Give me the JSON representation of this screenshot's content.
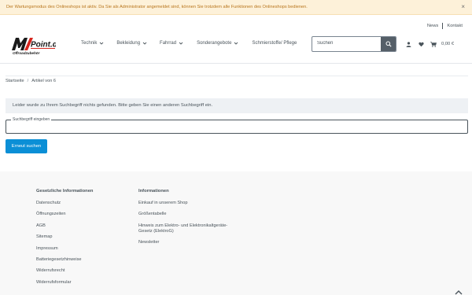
{
  "maintenance": {
    "text": "Der Wartungsmodus des Onlineshops ist aktiv. Da Sie als Administrator angemeldet sind, können Sie trotzdem alle Funktionen des Onlineshops bedienen.",
    "close": "×"
  },
  "top_links": {
    "news": "News",
    "contact": "Kontakt"
  },
  "logo": {
    "brand": "MX-Point.de",
    "tagline": "Offroadzubehör"
  },
  "nav": [
    {
      "label": "Technik",
      "dropdown": true
    },
    {
      "label": "Bekleidung",
      "dropdown": true
    },
    {
      "label": "Fahrrad",
      "dropdown": true
    },
    {
      "label": "Sonderangebote",
      "dropdown": true
    },
    {
      "label": "Schmierstoffe/ Pflege",
      "dropdown": false
    }
  ],
  "search": {
    "placeholder": "Suchen"
  },
  "cart": {
    "total": "0,00 €"
  },
  "breadcrumb": {
    "home": "Startseite",
    "current": "Artikel von 6"
  },
  "alert": {
    "text": "Leider wurde zu Ihrem Suchbegriff nichts gefunden. Bitte geben Sie einen anderen Suchbegriff ein."
  },
  "search_form": {
    "label": "Suchbegriff eingeben",
    "value": "",
    "button": "Erneut suchen"
  },
  "footer": {
    "legal": {
      "title": "Gesetzliche Informationen",
      "links": [
        "Datenschutz",
        "Öffnungszeiten",
        "AGB",
        "Sitemap",
        "Impressum",
        "Batteriegesetzhinweise",
        "Widerrufsrecht",
        "Widerrufsformular"
      ]
    },
    "info": {
      "title": "Informationen",
      "links": [
        "Einkauf in unserem Shop",
        "Größentabelle",
        "Hinweis zum Elektro- und Elektronikaltgeräte-Gesetz (ElektroG)",
        "Newsletter"
      ]
    }
  },
  "colors": {
    "accent": "#0b8fd6",
    "warning_bg": "#fdf1d9",
    "warning_text": "#b8751c",
    "logo_red": "#d7261e"
  },
  "icons": [
    "close-icon",
    "chevron-down-icon",
    "search-icon",
    "user-icon",
    "heart-icon",
    "cart-icon",
    "chevron-up-icon"
  ]
}
